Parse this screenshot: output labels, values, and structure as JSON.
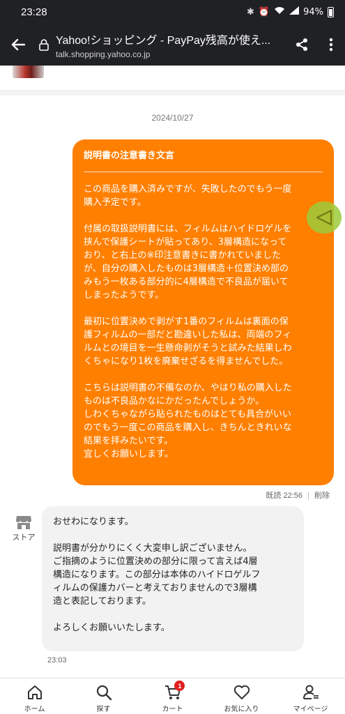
{
  "status_bar": {
    "time": "23:28",
    "battery": "94%"
  },
  "browser": {
    "title": "Yahoo!ショッピング - PayPay残高が使え...",
    "url": "talk.shopping.yahoo.co.jp"
  },
  "chat": {
    "date": "2024/10/27",
    "outgoing": {
      "subject": "説明書の注意書き文言",
      "paragraphs": [
        "この商品を購入済みですが、失敗したのでもう一度\n購入予定です。",
        "付属の取扱説明書には、フィルムはハイドロゲルを\n挟んで保護シートが貼ってあり、3層構造になって\nおり、と右上の※印注意書きに書かれていました\nが、自分の購入したものは3層構造＋位置決め部の\nみもう一枚ある部分的に4層構造で不良品が届いて\nしまったようです。",
        "最初に位置決めで剥がす1番のフィルムは裏面の保\n護フィルムの一部だと勘違いした私は、両端のフィ\nルムとの境目を一生懸命剥がそうと試みた結果しわ\nくちゃになり1枚を廃棄せざるを得ませんでした。",
        "こちらは説明書の不備なのか、やはり私の購入した\nものは不良品かなにかだったんでしょうか。\nしわくちゃながら貼られたものはとても具合がいい\nのでもう一度この商品を購入し、きちんときれいな\n結果を拝みたいです。\n宜しくお願いします。"
      ],
      "read_status": "既読",
      "time": "22:56",
      "delete_label": "削除"
    },
    "incoming": {
      "sender_label": "ストア",
      "paragraphs": [
        "おせわになります。",
        "説明書が分かりにくく大変申し訳ございません。\nご指摘のように位置決めの部分に限って言えば4層\n構造になります。この部分は本体のハイドロゲルフ\nィルムの保護カバーと考えておりませんので3層構\n造と表記しております。",
        "よろしくお願いいたします。"
      ],
      "time": "23:03"
    }
  },
  "bottom_nav": {
    "items": [
      {
        "label": "ホーム",
        "icon": "home-icon"
      },
      {
        "label": "探す",
        "icon": "search-icon"
      },
      {
        "label": "カート",
        "icon": "cart-icon",
        "badge": "1"
      },
      {
        "label": "お気に入り",
        "icon": "heart-icon"
      },
      {
        "label": "マイページ",
        "icon": "person-icon"
      }
    ]
  },
  "colors": {
    "outgoing_bubble": "#ff7f00",
    "incoming_bubble": "#f2f2f2",
    "badge": "#e0201e",
    "float_button": "#9ccc3b"
  }
}
